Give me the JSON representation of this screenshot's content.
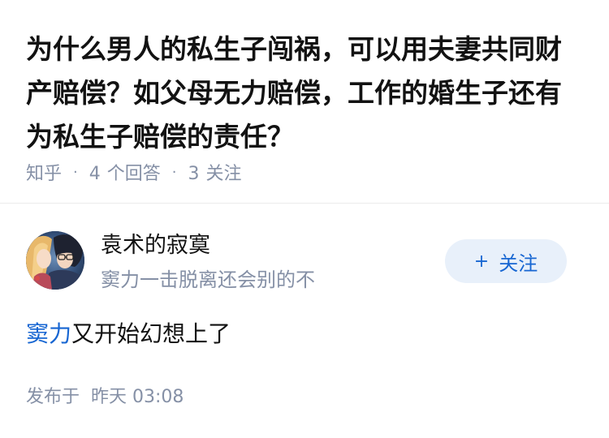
{
  "question": {
    "title": "为什么男人的私生子闯祸，可以用夫妻共同财产赔偿？如父母无力赔偿，工作的婚生子还有为私生子赔偿的责任？",
    "meta": {
      "source": "知乎",
      "separator": "·",
      "answer_count": "4",
      "answer_unit": "个回答",
      "follow_count": "3",
      "follow_unit": "关注"
    }
  },
  "answer": {
    "author": {
      "name": "袁术的寂寞",
      "bio": "窦力一击脱离还会别的不",
      "avatar_icon": "anime-avatar"
    },
    "follow_button": {
      "icon": "plus-icon",
      "plus": "+",
      "label": "关注"
    },
    "content": {
      "mention": "窦力",
      "text": "又开始幻想上了"
    },
    "time": {
      "label": "发布于",
      "value": "昨天 03:08"
    }
  },
  "colors": {
    "accent": "#1766d2",
    "muted": "#8590a6",
    "button_bg": "#e8f0fa",
    "text": "#121212"
  }
}
